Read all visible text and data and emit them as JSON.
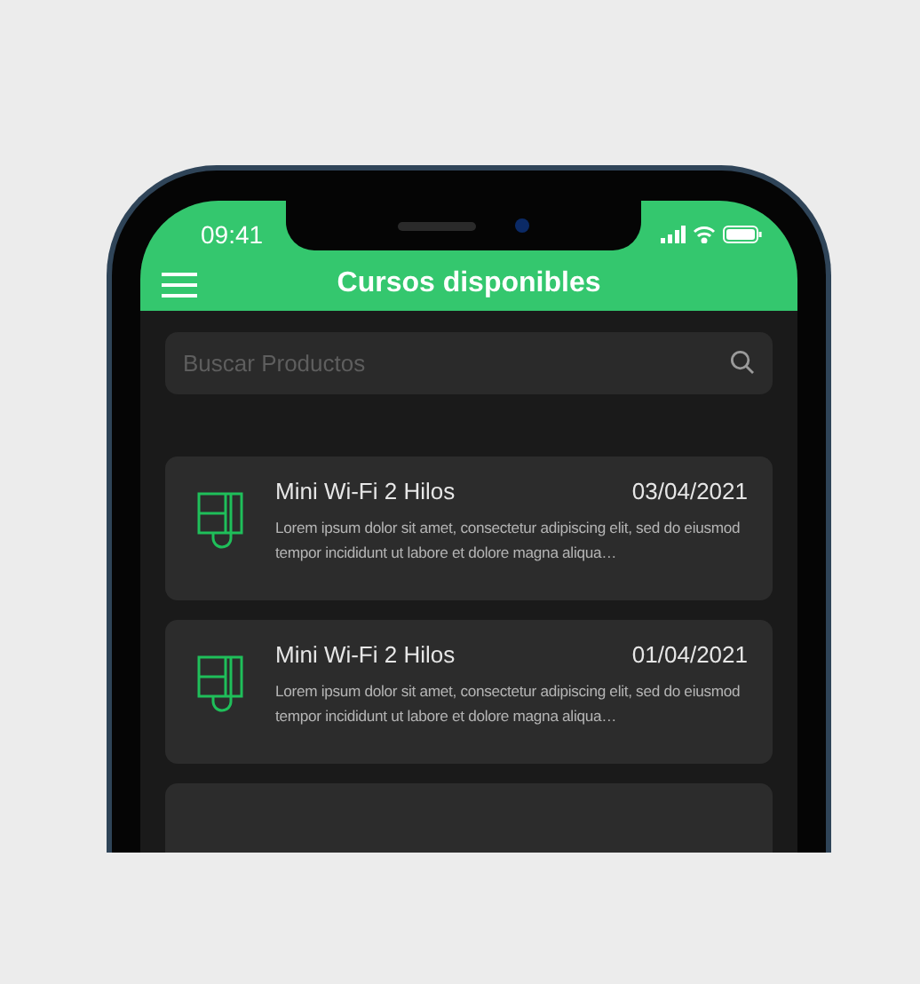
{
  "status_bar": {
    "time": "09:41"
  },
  "header": {
    "title": "Cursos disponibles"
  },
  "search": {
    "placeholder": "Buscar Productos"
  },
  "courses": [
    {
      "title": "Mini Wi-Fi 2 Hilos",
      "date": "03/04/2021",
      "description": "Lorem ipsum dolor sit amet, consectetur adipiscing elit, sed do eiusmod tempor incididunt ut labore et dolore magna aliqua…"
    },
    {
      "title": "Mini Wi-Fi 2 Hilos",
      "date": "01/04/2021",
      "description": "Lorem ipsum dolor sit amet, consectetur adipiscing elit, sed do eiusmod tempor incididunt ut labore et dolore magna aliqua…"
    }
  ]
}
